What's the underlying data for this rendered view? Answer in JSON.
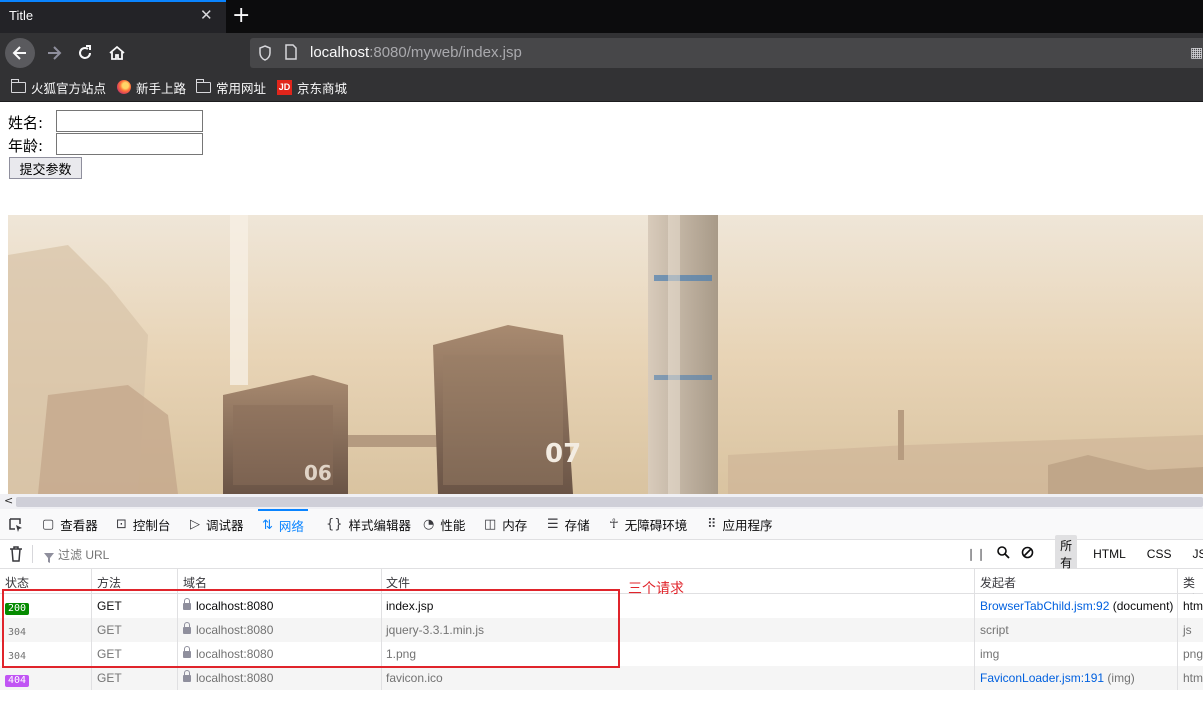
{
  "browser": {
    "tab_title": "Title",
    "tab_close": "✕",
    "new_tab": "+",
    "url_host": "localhost",
    "url_rest": ":8080/myweb/index.jsp",
    "bookmarks": [
      {
        "label": "火狐官方站点",
        "icon": "folder-icon"
      },
      {
        "label": "新手上路",
        "icon": "firefox-icon"
      },
      {
        "label": "常用网址",
        "icon": "folder-icon"
      },
      {
        "label": "京东商城",
        "icon": "jd-icon",
        "icon_text": "JD"
      }
    ]
  },
  "form": {
    "name_label": "姓名:",
    "age_label": "年龄:",
    "submit_label": "提交参数"
  },
  "devtools": {
    "tabs": [
      {
        "label": "查看器",
        "icon": "inspector-icon"
      },
      {
        "label": "控制台",
        "icon": "console-icon"
      },
      {
        "label": "调试器",
        "icon": "debugger-icon"
      },
      {
        "label": "网络",
        "icon": "network-icon",
        "active": true
      },
      {
        "label": "样式编辑器",
        "icon": "style-editor-icon"
      },
      {
        "label": "性能",
        "icon": "performance-icon"
      },
      {
        "label": "内存",
        "icon": "memory-icon"
      },
      {
        "label": "存储",
        "icon": "storage-icon"
      },
      {
        "label": "无障碍环境",
        "icon": "accessibility-icon"
      },
      {
        "label": "应用程序",
        "icon": "application-icon"
      }
    ],
    "filter_placeholder": "过滤 URL",
    "filter_types": [
      "所有",
      "HTML",
      "CSS",
      "JS"
    ],
    "columns": [
      "状态",
      "方法",
      "域名",
      "文件",
      "发起者",
      "类型"
    ],
    "rows": [
      {
        "status": "200",
        "status_color": "#058b00",
        "method": "GET",
        "domain": "localhost:8080",
        "file": "index.jsp",
        "initiator": "BrowserTabChild.jsm:92",
        "initiator_suffix": " (document)",
        "type": "html"
      },
      {
        "status": "304",
        "status_color": "",
        "method": "GET",
        "domain": "localhost:8080",
        "file": "jquery-3.3.1.min.js",
        "initiator": "",
        "initiator_suffix": "script",
        "type": "js"
      },
      {
        "status": "304",
        "status_color": "",
        "method": "GET",
        "domain": "localhost:8080",
        "file": "1.png",
        "initiator": "",
        "initiator_suffix": "img",
        "type": "png"
      },
      {
        "status": "404",
        "status_color": "#c155f4",
        "method": "GET",
        "domain": "localhost:8080",
        "file": "favicon.ico",
        "initiator": "FaviconLoader.jsm:191",
        "initiator_suffix": " (img)",
        "type": "html"
      }
    ]
  },
  "annotation": {
    "text": "三个请求",
    "color": "#e0242b"
  },
  "hero_image": {
    "building_labels": [
      "06",
      "07"
    ]
  }
}
